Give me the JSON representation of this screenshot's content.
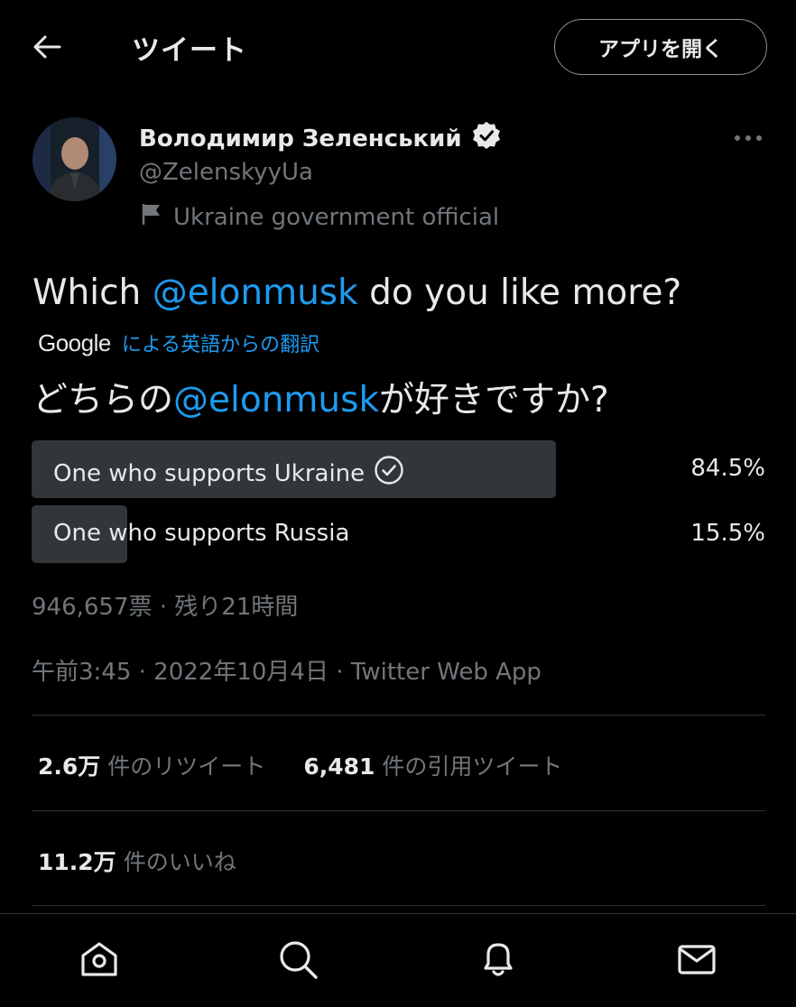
{
  "header": {
    "back_icon": "arrow-left-icon",
    "title": "ツイート",
    "open_app_label": "アプリを開く"
  },
  "author": {
    "name": "Володимир Зеленський",
    "handle": "@ZelenskyyUa",
    "verified_icon": "verified-badge-icon",
    "label_icon": "flag-icon",
    "label": "Ukraine government official",
    "more_icon": "more-horizontal-icon"
  },
  "tweet": {
    "text_before": "Which ",
    "mention": "@elonmusk",
    "text_after": " do you like more?",
    "translation_provider": "Google",
    "translation_note": "による英語からの翻訳",
    "translated_before": "どちらの",
    "translated_mention": "@elonmusk",
    "translated_after": "が好きですか?"
  },
  "poll": {
    "options": [
      {
        "label": "One who supports Ukraine",
        "percent_text": "84.5%",
        "percent": 84.5,
        "winner": true
      },
      {
        "label": "One who supports Russia",
        "percent_text": "15.5%",
        "percent": 15.5,
        "winner": false
      }
    ],
    "votes_meta": "946,657票 · 残り21時間"
  },
  "timestamp": "午前3:45 · 2022年10月4日 · Twitter Web App",
  "stats": {
    "retweets_num": "2.6万",
    "retweets_label": "件のリツイート",
    "quotes_num": "6,481",
    "quotes_label": "件の引用ツイート",
    "likes_num": "11.2万",
    "likes_label": "件のいいね"
  },
  "bottom_nav": [
    "home-icon",
    "search-icon",
    "notifications-bell-icon",
    "messages-mail-icon"
  ],
  "colors": {
    "background": "#000000",
    "accent": "#1d9bf0",
    "muted": "#71767b",
    "poll_bar": "#333639"
  }
}
